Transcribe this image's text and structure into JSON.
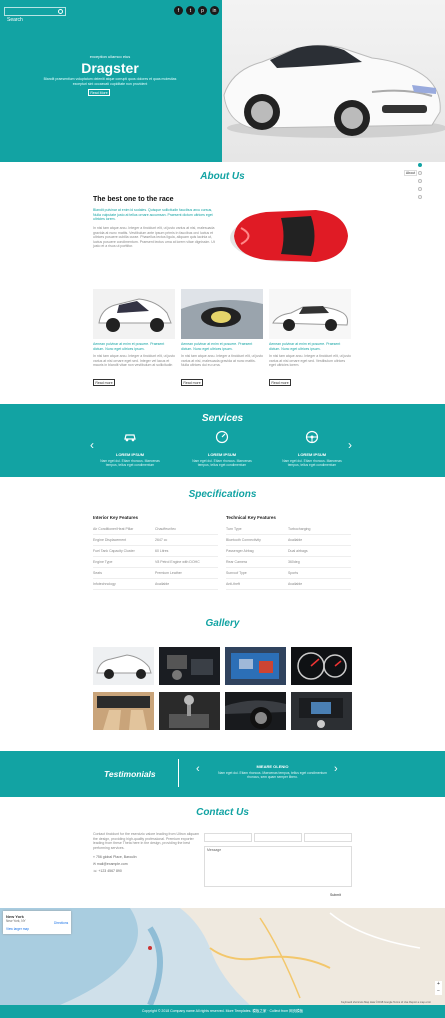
{
  "header": {
    "search_placeholder": "Search",
    "social": [
      "f",
      "t",
      "p",
      "in"
    ]
  },
  "hero": {
    "tagline": "exception ullamco eius",
    "title": "Dragster",
    "description": "Blandit praesentium voluptatum deleniti atque corrupti quos dolores et quas molestias excepturi sint occaecati cupiditate non provident",
    "button": "Read More"
  },
  "side": {
    "label": "About"
  },
  "about": {
    "title": "About Us",
    "heading": "The best one to the race",
    "intro_teal": "Blandit pulvinar at enim id sodales. Quisque sollicitudin faucibus arcu cursus, Nulla vulputate justo at tellus ornare accumsan. Praesent dictum ultrices eget ultricies lorem.",
    "intro_grey": "In nisi tam atque arcu. Integer a tincidunt elit, ut justo varius at nisi, malesuada gravida at nunc mattis. Vestibulum ante ipsum primis in faucibus orci luctus et ultrices posuere cubilia curae. Phasellus lectus ligula, aliquam quis lacinia ut, luctus posuere condimentum. Praesent lectus urna at lorem vitae dignissim. Ut justo et a risus ut porttitor.",
    "cards": [
      {
        "teal": "Aenean pulvinar at enim et posuere. Praesent dictum. Nunc eget ultrices ipsum.",
        "grey": "In nisi tam atque arcu. Integer a tincidunt elit, ut justo varius at nisi ornare eget sed. Integer vel lacus et mauris in blandit vitae non vestibulum at sollicitudin",
        "button": "Read more"
      },
      {
        "teal": "Aenean pulvinar at enim et posuere. Praesent dictum. Nunc eget ultrices ipsum.",
        "grey": "In nisi tam atque arcu. Integer a tincidunt elit, ut justo varius at nisi, malesuada gravida at nunc mattis. Nulla ultrices dui eu urna.",
        "button": "Read more"
      },
      {
        "teal": "Aenean pulvinar at enim et posuere. Praesent dictum. Nunc eget ultrices ipsum.",
        "grey": "In nisi tam atque arcu. Integer a tincidunt elit, ut justo varius at nisi ornare eget sed. Vestibulum ultrices eget ultricies lorem.",
        "button": "Read more"
      }
    ]
  },
  "services": {
    "title": "Services",
    "items": [
      {
        "icon": "car-icon",
        "name": "LOREM IPSUM",
        "desc": "Nam eget dui. Etiam rhoncus. Maecenas tempus, tellus eget condimentum"
      },
      {
        "icon": "gauge-icon",
        "name": "LOREM IPSUM",
        "desc": "Nam eget dui. Etiam rhoncus. Maecenas tempus, tellus eget condimentum"
      },
      {
        "icon": "steering-wheel-icon",
        "name": "LOREM IPSUM",
        "desc": "Nam eget dui. Etiam rhoncus. Maecenas tempus, tellus eget condimentum"
      }
    ]
  },
  "specifications": {
    "title": "Specifications",
    "interior_heading": "Interior Key Features",
    "technical_heading": "Technical Key Features",
    "interior_rows": [
      [
        "Air Conditioner/Heat Pillar",
        "Chauffeur/tec"
      ],
      [
        "Engine Displacement",
        "2647 cc"
      ],
      [
        "Fuel Tank Capacity Cluster",
        "60 Litres"
      ],
      [
        "Engine Type",
        "V8 Petrol Engine with DOHC"
      ],
      [
        "Seats",
        "Premium Leather"
      ],
      [
        "Infotechnology",
        "Available"
      ]
    ],
    "technical_rows": [
      [
        "Turn Type",
        "Turbocharging"
      ],
      [
        "Bluetooth Connectivity",
        "Available"
      ],
      [
        "Passenger Airbag",
        "Dual airbags"
      ],
      [
        "Rear Camera",
        "360deg"
      ],
      [
        "Sunroof Type",
        "Sports"
      ],
      [
        "Anti-theft",
        "Available"
      ]
    ]
  },
  "gallery": {
    "title": "Gallery",
    "images": [
      "white-suv",
      "engine-bay",
      "blue-engine",
      "speedometer",
      "tan-interior",
      "gear-stick",
      "black-wheel",
      "dashboard"
    ]
  },
  "testimonials": {
    "title": "Testimonials",
    "name": "MIEARE OLENIO",
    "quote": "Nam eget dui. Etiam rhoncus. Maecenas tempus, tellus eget condimentum rhoncus, sem quam semper libero."
  },
  "contact": {
    "title": "Contact Us",
    "text": "Contact tincidunt for the esercizio valore leading from Ultron aliquam the design, providing high-quality professional. Premium exporter leading from these Theta here in the design, providing the best performing services.",
    "address": "756 global Place, Baroulin",
    "email": "mail@example.com",
    "phone": "+123 4567 890",
    "field_labels": [
      "Name",
      "Email",
      "Subject"
    ],
    "message_label": "Message",
    "submit": "Submit"
  },
  "map": {
    "place": "New York",
    "place_sub": "New York, NY",
    "directions": "Directions",
    "larger_map": "View larger map",
    "attribution": "Keyboard shortcuts  Map data ©2018 Google  Terms of Use  Report a map error"
  },
  "footer": {
    "text": "Copyright © 2018 Company name All rights reserved. More Templates. 模板之家 · Collect from 网页模板"
  }
}
